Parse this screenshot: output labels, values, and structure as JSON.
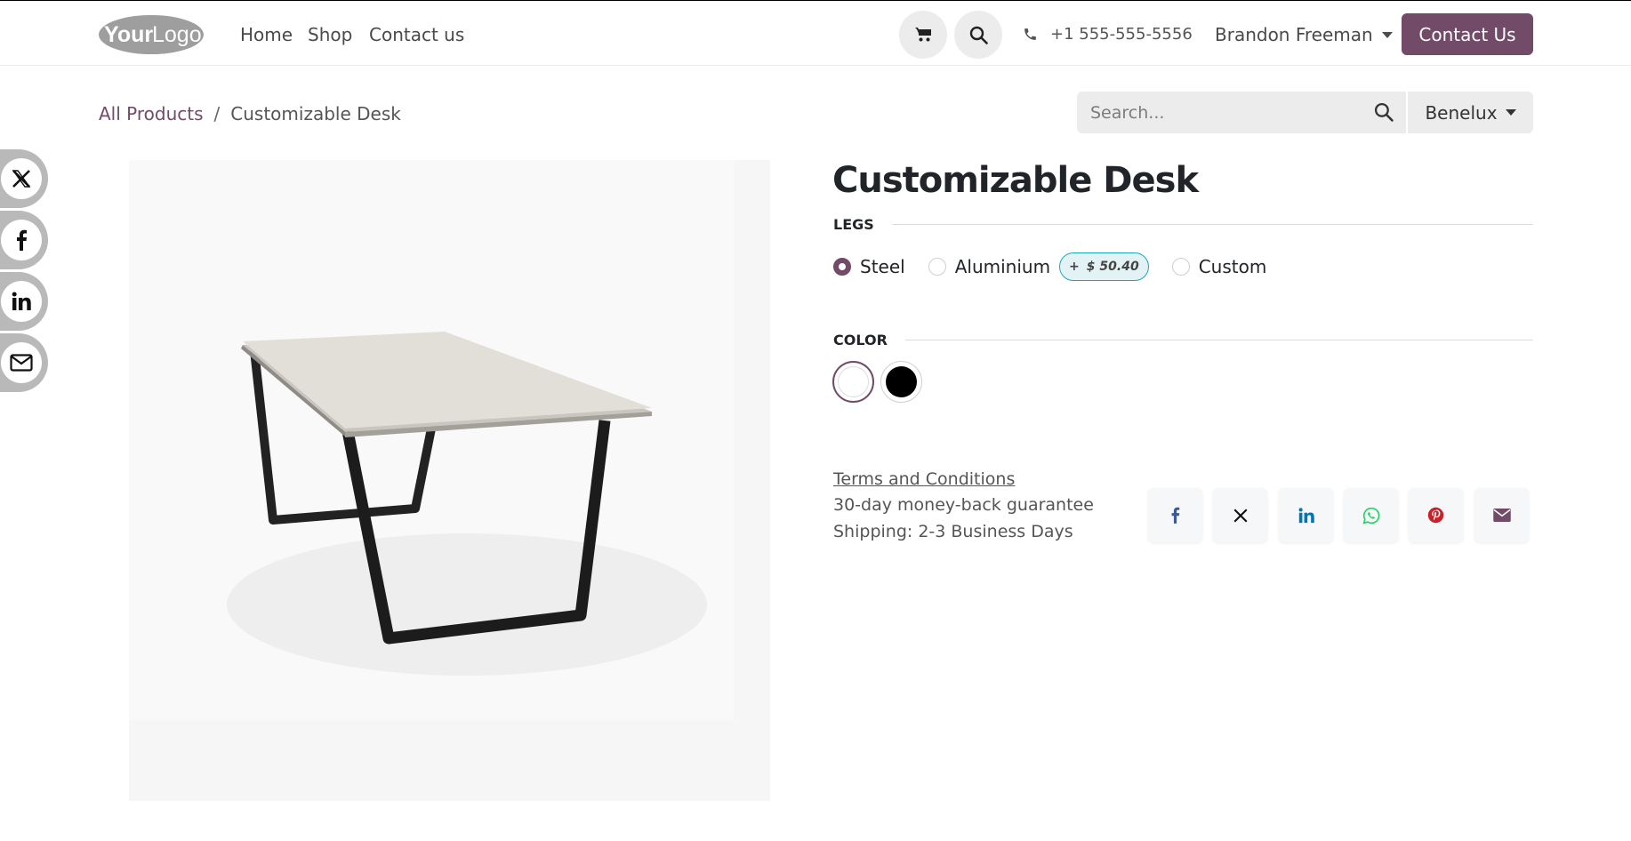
{
  "header": {
    "logo_text": "YourLogo",
    "nav": [
      "Home",
      "Shop",
      "Contact us"
    ],
    "phone": "+1 555-555-5556",
    "user_name": "Brandon Freeman",
    "contact_button": "Contact Us"
  },
  "breadcrumb": {
    "all_products": "All Products",
    "separator": "/",
    "current": "Customizable Desk"
  },
  "search": {
    "placeholder": "Search...",
    "region": "Benelux"
  },
  "product": {
    "name": "Customizable Desk",
    "legs_label": "LEGS",
    "legs_options": [
      {
        "label": "Steel",
        "selected": true
      },
      {
        "label": "Aluminium",
        "selected": false,
        "extra_price_sign": "+",
        "extra_price": "$ 50.40"
      },
      {
        "label": "Custom",
        "selected": false
      }
    ],
    "color_label": "COLOR",
    "colors": [
      {
        "name": "White",
        "hex": "#ffffff",
        "selected": true
      },
      {
        "name": "Black",
        "hex": "#000000",
        "selected": false
      }
    ],
    "terms_link": "Terms and Conditions",
    "guarantee": "30-day money-back guarantee",
    "shipping": "Shipping: 2-3 Business Days"
  },
  "share_icons": [
    "facebook-icon",
    "x-icon",
    "linkedin-icon",
    "whatsapp-icon",
    "pinterest-icon",
    "email-icon"
  ],
  "colors": {
    "brand": "#714b67",
    "facebook": "#3b5998",
    "linkedin": "#0077b5",
    "whatsapp": "#25d366",
    "pinterest": "#cb2027"
  }
}
